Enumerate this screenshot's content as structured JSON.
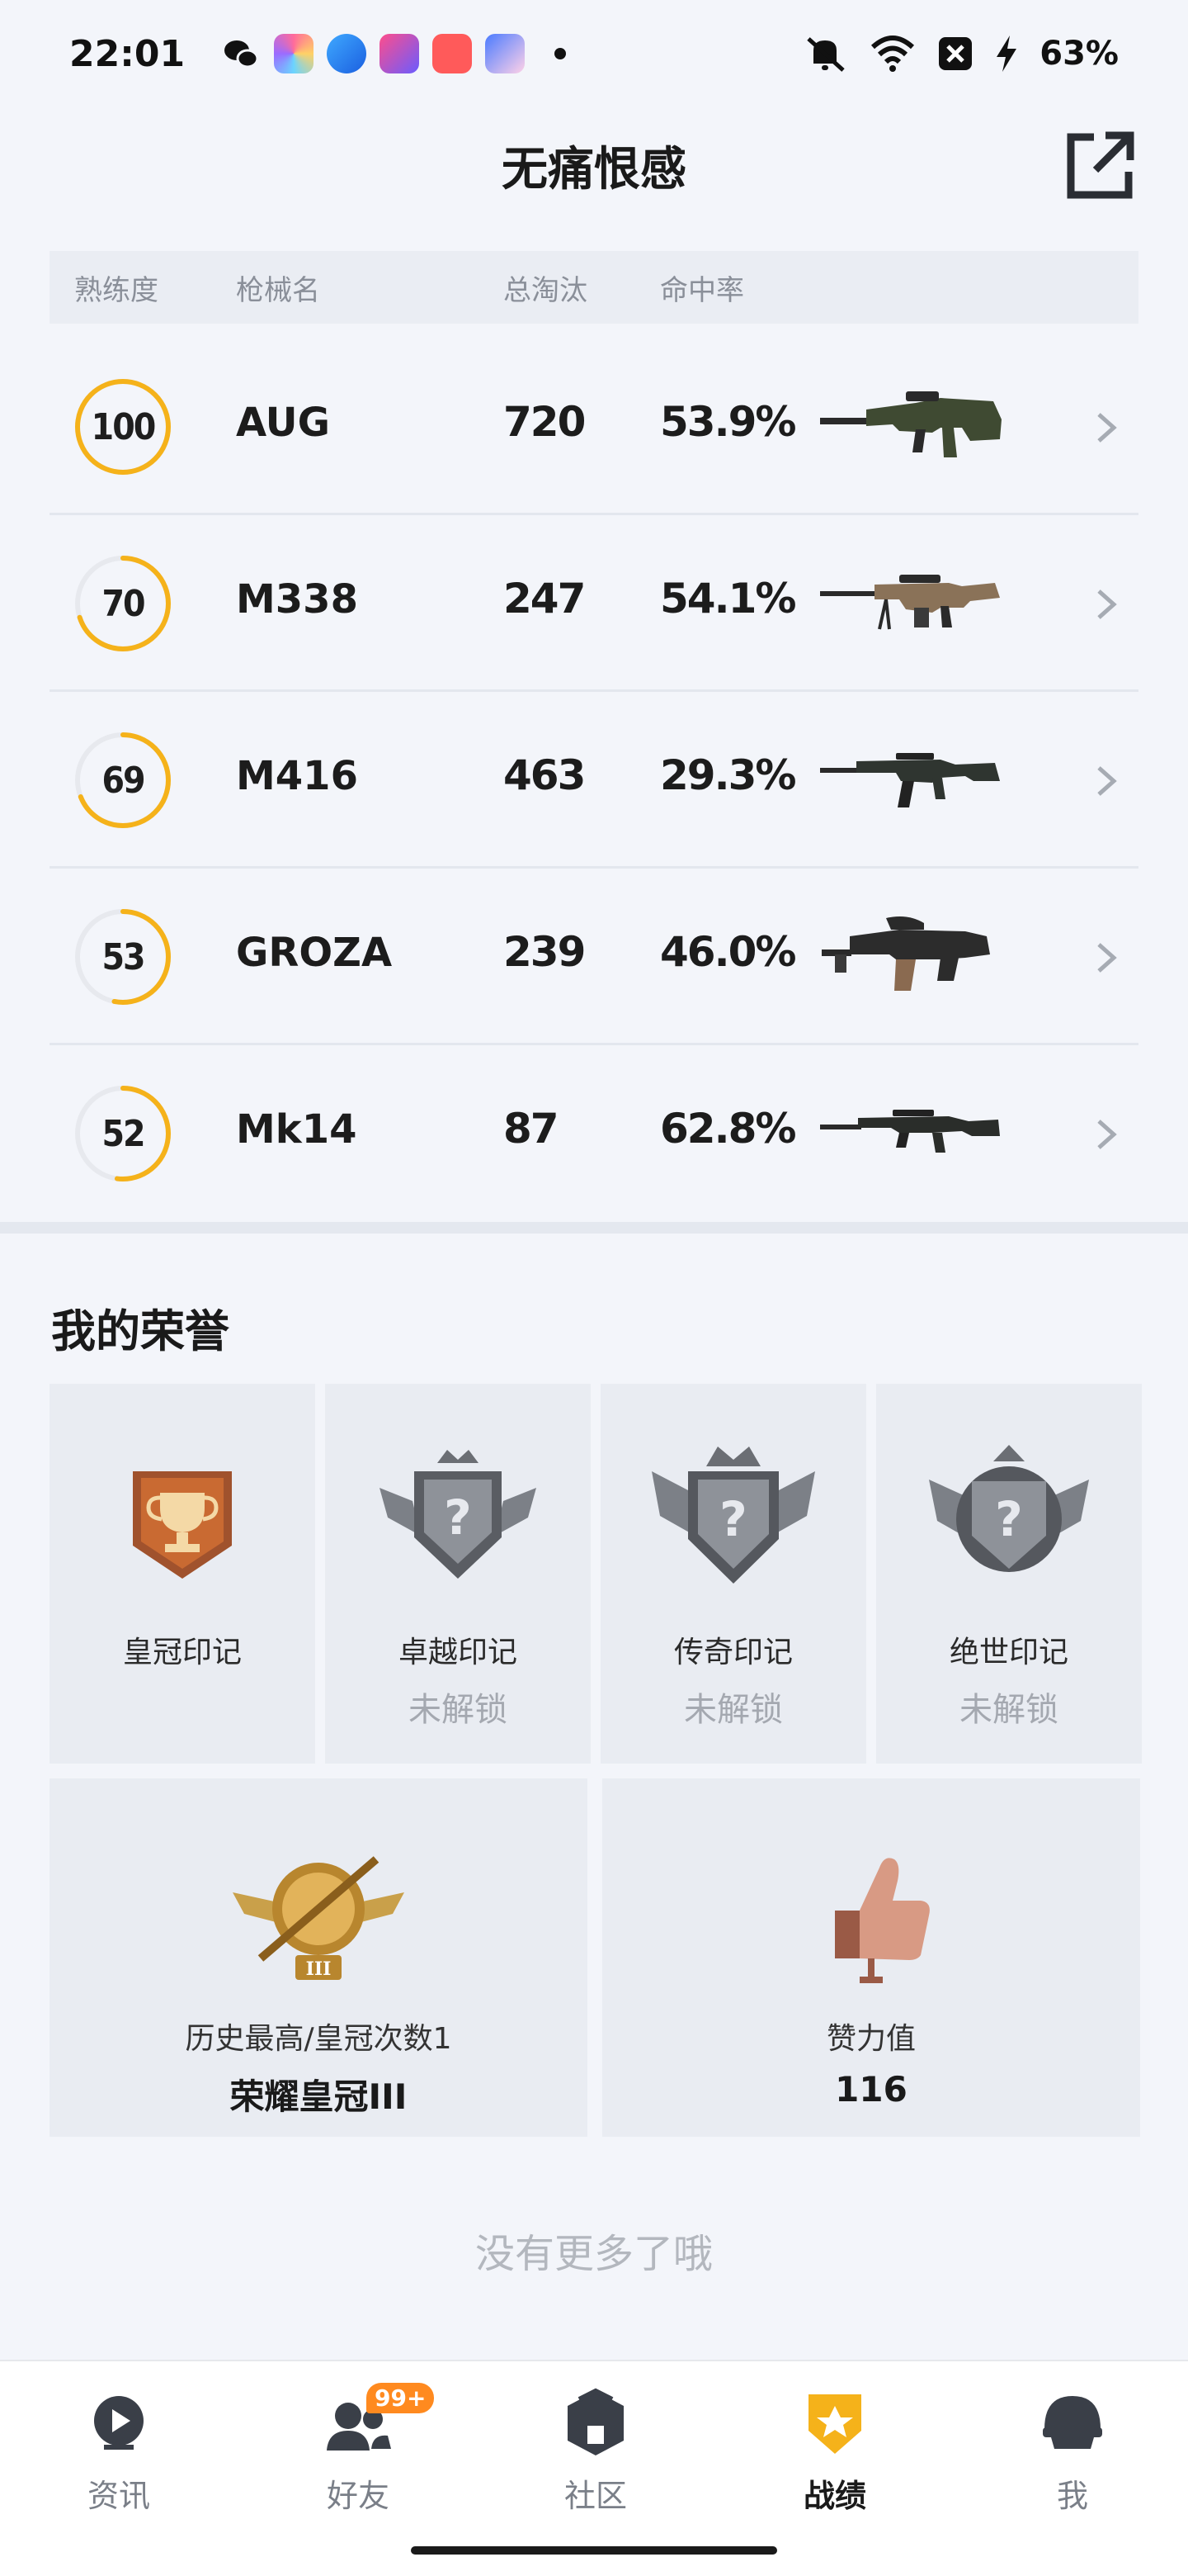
{
  "status_bar": {
    "time": "22:01",
    "battery": "63%",
    "icons": [
      "wechat-icon",
      "app-icon",
      "app-icon",
      "app-icon",
      "video-icon",
      "game-icon",
      "notification-dot",
      "mute-icon",
      "wifi-icon",
      "sim-off-icon",
      "charging-icon"
    ]
  },
  "header": {
    "title": "无痛恨感",
    "action_icon": "share-icon"
  },
  "table": {
    "headers": {
      "mastery": "熟练度",
      "name": "枪械名",
      "kills": "总淘汰",
      "hit_rate": "命中率"
    },
    "rows": [
      {
        "mastery": "100",
        "mastery_pct": 1.0,
        "name": "AUG",
        "kills": "720",
        "hit_rate": "53.9%"
      },
      {
        "mastery": "70",
        "mastery_pct": 0.7,
        "name": "M338",
        "kills": "247",
        "hit_rate": "54.1%"
      },
      {
        "mastery": "69",
        "mastery_pct": 0.69,
        "name": "M416",
        "kills": "463",
        "hit_rate": "29.3%"
      },
      {
        "mastery": "53",
        "mastery_pct": 0.53,
        "name": "GROZA",
        "kills": "239",
        "hit_rate": "46.0%"
      },
      {
        "mastery": "52",
        "mastery_pct": 0.52,
        "name": "Mk14",
        "kills": "87",
        "hit_rate": "62.8%"
      }
    ]
  },
  "honors": {
    "title": "我的荣誉",
    "badges": [
      {
        "name": "皇冠印记",
        "status": "",
        "icon": "trophy-badge-icon"
      },
      {
        "name": "卓越印记",
        "status": "未解锁",
        "icon": "locked-badge-icon"
      },
      {
        "name": "传奇印记",
        "status": "未解锁",
        "icon": "locked-badge-icon"
      },
      {
        "name": "绝世印记",
        "status": "未解锁",
        "icon": "locked-badge-icon"
      }
    ],
    "highest": {
      "label": "历史最高/皇冠次数1",
      "value": "荣耀皇冠III",
      "icon": "crown-rank-icon"
    },
    "likes": {
      "label": "赞力值",
      "value": "116",
      "icon": "thumbs-up-icon"
    }
  },
  "footer_note": "没有更多了哦",
  "nav": {
    "items": [
      {
        "label": "资讯",
        "icon": "news-icon"
      },
      {
        "label": "好友",
        "icon": "friends-icon",
        "badge": "99+"
      },
      {
        "label": "社区",
        "icon": "community-icon"
      },
      {
        "label": "战绩",
        "icon": "record-icon",
        "active": true
      },
      {
        "label": "我",
        "icon": "profile-icon"
      }
    ]
  },
  "colors": {
    "accent": "#f5b21a",
    "ring_track": "#e7e9ee",
    "badge_orange": "#ff8a1f"
  }
}
